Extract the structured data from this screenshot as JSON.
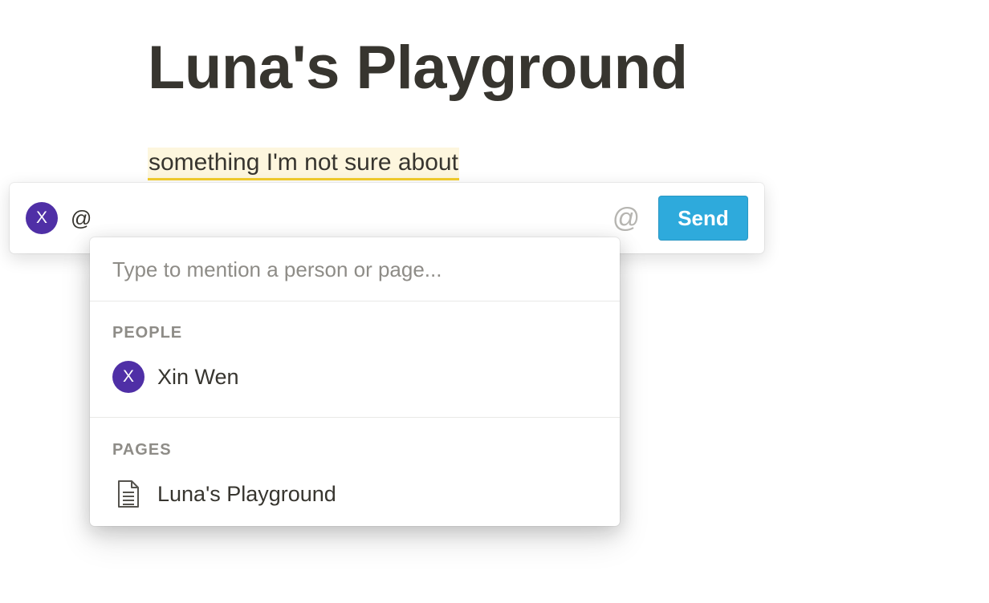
{
  "page": {
    "title": "Luna's Playground",
    "highlighted_text": "something I'm not sure about"
  },
  "comment": {
    "avatar_initial": "X",
    "input_value": "@",
    "mention_icon": "@",
    "send_label": "Send"
  },
  "mention_menu": {
    "hint": "Type to mention a person or page...",
    "people_label": "PEOPLE",
    "people": [
      {
        "initial": "X",
        "name": "Xin Wen"
      }
    ],
    "pages_label": "PAGES",
    "pages": [
      {
        "icon": "document-icon",
        "name": "Luna's Playground"
      }
    ]
  },
  "colors": {
    "avatar": "#4f2fa6",
    "send_button": "#2eaadc",
    "highlight_background": "#fdf6de",
    "highlight_underline": "#f3cc2b"
  }
}
